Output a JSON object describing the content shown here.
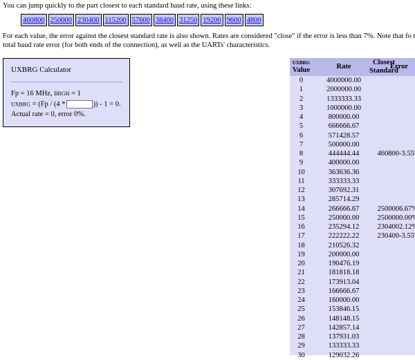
{
  "intro": "You can jump quickly to the part closest to each standard baud rate, using these links:",
  "links": [
    "460800",
    "250000",
    "230400",
    "115200",
    "57600",
    "38400",
    "31250",
    "19200",
    "9600",
    "4800"
  ],
  "note": "For each value, the error against the closest standard rate is also shown. Rates are considered \"close\" if the error is less than 7%. Note that fo the total baud rate error (for both ends of the connection), as well as the UARTs' characteristics.",
  "calculator": {
    "title": "UXBRG Calculator",
    "fp_line": "Fp = 16 MHz,",
    "brgh_label": "BRGH",
    "brgh_value": "= 1",
    "formula_prefix_small": "UXBRG",
    "formula_prefix": "= (Fp / (4 *",
    "formula_suffix": ")) - 1 = 0.",
    "input_value": "",
    "result": "Actual rate = 0, error 0%."
  },
  "table": {
    "headers": {
      "value_top": "UXBRG",
      "value_bottom": "Value",
      "rate": "Rate",
      "closest_top": "Closest",
      "closest_bottom": "Standard",
      "error": "Error"
    },
    "rows": [
      {
        "v": "0",
        "rate": "4000000.00",
        "std": "",
        "err": ""
      },
      {
        "v": "1",
        "rate": "2000000.00",
        "std": "",
        "err": ""
      },
      {
        "v": "2",
        "rate": "1333333.33",
        "std": "",
        "err": ""
      },
      {
        "v": "3",
        "rate": "1000000.00",
        "std": "",
        "err": ""
      },
      {
        "v": "4",
        "rate": "800000.00",
        "std": "",
        "err": ""
      },
      {
        "v": "5",
        "rate": "666666.67",
        "std": "",
        "err": ""
      },
      {
        "v": "6",
        "rate": "571428.57",
        "std": "",
        "err": ""
      },
      {
        "v": "7",
        "rate": "500000.00",
        "std": "",
        "err": ""
      },
      {
        "v": "8",
        "rate": "444444.44",
        "std": "460800",
        "err": "-3.55%"
      },
      {
        "v": "9",
        "rate": "400000.00",
        "std": "",
        "err": ""
      },
      {
        "v": "10",
        "rate": "363636.36",
        "std": "",
        "err": ""
      },
      {
        "v": "11",
        "rate": "333333.33",
        "std": "",
        "err": ""
      },
      {
        "v": "12",
        "rate": "307692.31",
        "std": "",
        "err": ""
      },
      {
        "v": "13",
        "rate": "285714.29",
        "std": "",
        "err": ""
      },
      {
        "v": "14",
        "rate": "266666.67",
        "std": "250000",
        "err": "6.67%"
      },
      {
        "v": "15",
        "rate": "250000.00",
        "std": "250000",
        "err": "0.00%"
      },
      {
        "v": "16",
        "rate": "235294.12",
        "std": "230400",
        "err": "2.12%"
      },
      {
        "v": "17",
        "rate": "222222.22",
        "std": "230400",
        "err": "-3.55%"
      },
      {
        "v": "18",
        "rate": "210526.32",
        "std": "",
        "err": ""
      },
      {
        "v": "19",
        "rate": "200000.00",
        "std": "",
        "err": ""
      },
      {
        "v": "20",
        "rate": "190476.19",
        "std": "",
        "err": ""
      },
      {
        "v": "21",
        "rate": "181818.18",
        "std": "",
        "err": ""
      },
      {
        "v": "22",
        "rate": "173913.04",
        "std": "",
        "err": ""
      },
      {
        "v": "23",
        "rate": "166666.67",
        "std": "",
        "err": ""
      },
      {
        "v": "24",
        "rate": "160000.00",
        "std": "",
        "err": ""
      },
      {
        "v": "25",
        "rate": "153846.15",
        "std": "",
        "err": ""
      },
      {
        "v": "26",
        "rate": "148148.15",
        "std": "",
        "err": ""
      },
      {
        "v": "27",
        "rate": "142857.14",
        "std": "",
        "err": ""
      },
      {
        "v": "28",
        "rate": "137931.03",
        "std": "",
        "err": ""
      },
      {
        "v": "29",
        "rate": "133333.33",
        "std": "",
        "err": ""
      },
      {
        "v": "30",
        "rate": "129032.26",
        "std": "",
        "err": ""
      }
    ]
  }
}
